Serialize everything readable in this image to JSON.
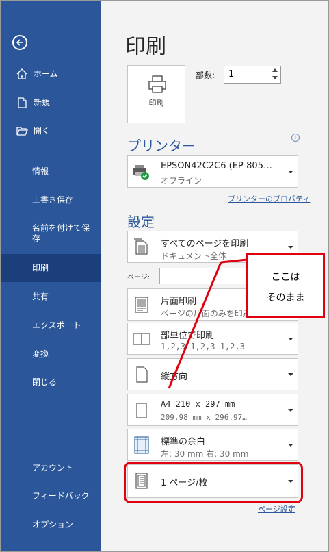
{
  "sidebar": {
    "back_icon": "back-arrow-icon",
    "items": [
      {
        "label": "ホーム",
        "icon": "home-icon"
      },
      {
        "label": "新規",
        "icon": "new-document-icon"
      },
      {
        "label": "開く",
        "icon": "folder-open-icon"
      },
      {
        "label": "情報"
      },
      {
        "label": "上書き保存"
      },
      {
        "label": "名前を付けて保存"
      },
      {
        "label": "印刷"
      },
      {
        "label": "共有"
      },
      {
        "label": "エクスポート"
      },
      {
        "label": "変換"
      },
      {
        "label": "閉じる"
      },
      {
        "label": "アカウント"
      },
      {
        "label": "フィードバック"
      },
      {
        "label": "オプション"
      }
    ],
    "active": "印刷",
    "bg_color": "#2b579a",
    "active_color": "#1b3f7a"
  },
  "main": {
    "title": "印刷",
    "print_button_label": "印刷",
    "copies_label": "部数:",
    "copies_value": "1",
    "printer_section": "プリンター",
    "printer": {
      "name": "EPSON42C2C6 (EP-805…",
      "status": "オフライン"
    },
    "printer_properties_link": "プリンターのプロパティ",
    "settings_section": "設定",
    "settings": [
      {
        "title": "すべてのページを印刷",
        "subtitle": "ドキュメント全体"
      },
      {
        "title": "片面印刷",
        "subtitle": "ページの片面のみを印刷"
      },
      {
        "title": "部単位で印刷",
        "subtitle": "1,2,3   1,2,3   1,2,3"
      },
      {
        "title": "縦方向",
        "subtitle": ""
      },
      {
        "title": "A4 210 x 297 mm",
        "subtitle": "209.98 mm x 296.97…"
      },
      {
        "title": "標準の余白",
        "subtitle": "左:  30 mm    右:  30 mm"
      },
      {
        "title": "1 ページ/枚",
        "subtitle": ""
      }
    ],
    "pages_label": "ページ:",
    "page_setup_link": "ページ設定"
  },
  "annotation": {
    "line1": "ここは",
    "line2": "そのまま",
    "color": "#e0000f"
  }
}
